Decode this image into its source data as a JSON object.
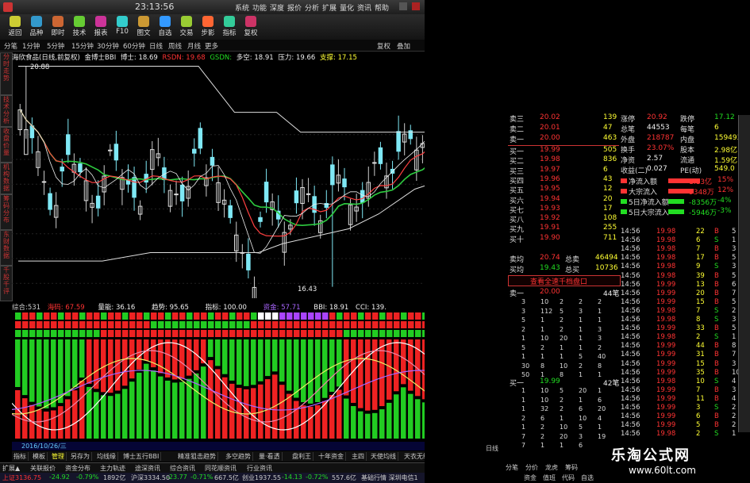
{
  "title_time": "23:13:56",
  "menu": [
    "系统",
    "功能",
    "深度",
    "报价",
    "分析",
    "扩展",
    "量化",
    "资讯",
    "帮助"
  ],
  "toolbar": [
    "返回",
    "品种",
    "即时",
    "技术",
    "报表",
    "F10",
    "图文",
    "自选",
    "交易",
    "步影",
    "指标",
    "复权"
  ],
  "period": [
    "分笔",
    "1分钟",
    "5分钟",
    "15分钟",
    "30分钟",
    "60分钟",
    "日线",
    "周线",
    "月线",
    "更多"
  ],
  "right_tabs": [
    "复权",
    "叠加"
  ],
  "indicator_line": {
    "name": "海欣食品(日线,前复权)",
    "bbi_label": "金博士BBI",
    "bbi": "博士: 18.69",
    "rsdn": "RSDN: 19.68",
    "gsdn": "GSDN:",
    "duokong": "多空: 18.91",
    "yali": "压力: 19.66",
    "zhicheng": "支撑: 17.15"
  },
  "price_high": "20.88",
  "price_low": "16.43",
  "chart_labels": {
    "yali": "压力",
    "duokong": "多空",
    "boshi": "博士"
  },
  "price_axis": [
    "19.50",
    "19.00",
    "18.50",
    "18.00",
    "17.50",
    "17.00",
    "16.50"
  ],
  "lower_header": {
    "zonghe": "综合:531",
    "haima": "海码: 67.59",
    "liangneng": "量能: 36.16",
    "qushi": "趋势: 95.65",
    "zhibiao": "指标: 100.00",
    "zijin": "资金: 57.71",
    "bbi": "BBI: 18.91",
    "cci": "CCI: 139."
  },
  "lower_right": [
    "BBI控:波段",
    "CCI:139.",
    "BBI:18.9",
    "海: 97.59",
    "量: 36.16",
    "势: 95.65",
    "指: 100.0",
    "金: 57.71"
  ],
  "lower_axis": [
    "600.0",
    "500.0",
    "400.0",
    "300.0",
    "200.0",
    "100.0"
  ],
  "date_label": "2016/10/26/三",
  "left_vtabs": [
    "分时走势",
    "技术分析",
    "收盘价量",
    "机构数据",
    "筹码分布",
    "东财数据",
    "千股千评"
  ],
  "bottom_tabs": [
    "指标",
    "模板",
    "管理",
    "另存为",
    "均线缘",
    "博士五行BBI",
    "精准狙击趋势",
    "多空趋势",
    "量·看透",
    "盘利王",
    "十年资金",
    "主四",
    "天使均线",
    "天衣无缝"
  ],
  "bottom_tabs2": [
    "扩展▲",
    "关联报价",
    "资金分布",
    "主力轨迹",
    "途深资讯",
    "综合资讯",
    "同花顺资讯",
    "行业资讯"
  ],
  "status": {
    "sh": "上证3136.75",
    "sh_chg": "-24.92",
    "sh_pct": "-0.79%",
    "sh_amt": "1892亿",
    "sz": "沪深3334.50",
    "sz_chg": "-23.77",
    "sz_pct": "-0.71%",
    "sz_amt": "667.5亿",
    "cy": "创业1937.55",
    "cy_chg": "-14.13",
    "cy_pct": "-0.72%",
    "cy_amt": "557.6亿"
  },
  "status_right": "基础行情 深圳电信1",
  "orderbook_sell": [
    {
      "l": "卖三",
      "p": "20.02",
      "v": "139"
    },
    {
      "l": "卖二",
      "p": "20.01",
      "v": "47"
    },
    {
      "l": "卖一",
      "p": "20.00",
      "v": "463"
    }
  ],
  "orderbook_buy": [
    {
      "l": "买一",
      "p": "19.99",
      "v": "505"
    },
    {
      "l": "买二",
      "p": "19.98",
      "v": "836"
    },
    {
      "l": "买三",
      "p": "19.97",
      "v": "6"
    },
    {
      "l": "买四",
      "p": "19.96",
      "v": "43"
    },
    {
      "l": "买五",
      "p": "19.95",
      "v": "12"
    },
    {
      "l": "买六",
      "p": "19.94",
      "v": "20"
    },
    {
      "l": "买七",
      "p": "19.93",
      "v": "17"
    },
    {
      "l": "买八",
      "p": "19.92",
      "v": "108"
    },
    {
      "l": "买九",
      "p": "19.91",
      "v": "255"
    },
    {
      "l": "买十",
      "p": "19.90",
      "v": "711"
    }
  ],
  "avg_sell": {
    "l": "卖均",
    "p": "20.74",
    "t": "总卖",
    "v": "46494"
  },
  "avg_buy": {
    "l": "买均",
    "p": "19.43",
    "t": "总买",
    "v": "10736"
  },
  "stats": [
    {
      "a": "涨停",
      "b": "20.92",
      "c": "跌停",
      "d": "17.12"
    },
    {
      "a": "总笔",
      "b": "44553",
      "c": "每笔",
      "d": "6"
    },
    {
      "a": "外盘",
      "b": "218787",
      "c": "内盘",
      "d": "159493"
    },
    {
      "a": "换手",
      "b": "23.07%",
      "c": "股本",
      "d": "2.98亿"
    },
    {
      "a": "净资",
      "b": "2.57",
      "c": "流通",
      "d": "1.59亿"
    },
    {
      "a": "收益(二)",
      "b": "0.027",
      "c": "PE(动)",
      "d": "549.0"
    }
  ],
  "flows": [
    {
      "l": "净流入额",
      "v": "1.13亿",
      "p": "15%"
    },
    {
      "l": "大宗流入",
      "v": "9348万",
      "p": "12%"
    },
    {
      "l": "5日净流入额",
      "v": "-8356万",
      "p": "-4%"
    },
    {
      "l": "5日大宗流入",
      "v": "-5946万",
      "p": "-3%"
    }
  ],
  "queue_title": "查看全速千档盘口",
  "queue_sell": {
    "l": "卖一",
    "p": "20.00",
    "n": "44笔"
  },
  "queue_buy": {
    "l": "买一",
    "p": "19.99",
    "n": "42笔"
  },
  "queue_sell_rows": [
    [
      "3",
      "10",
      "2",
      "2",
      "2"
    ],
    [
      "3",
      "112",
      "5",
      "3",
      "1"
    ],
    [
      "5",
      "1",
      "2",
      "1",
      "1"
    ],
    [
      "2",
      "1",
      "2",
      "1",
      "3"
    ],
    [
      "1",
      "10",
      "20",
      "1",
      "3"
    ],
    [
      "5",
      "2",
      "1",
      "1",
      "2"
    ],
    [
      "1",
      "1",
      "1",
      "5",
      "40"
    ],
    [
      "30",
      "8",
      "10",
      "2",
      "8"
    ],
    [
      "50",
      "1",
      "8",
      "1",
      "1"
    ]
  ],
  "queue_buy_rows": [
    [
      "1",
      "10",
      "5",
      "20",
      "1"
    ],
    [
      "1",
      "10",
      "2",
      "1",
      "6"
    ],
    [
      "1",
      "32",
      "2",
      "6",
      "20"
    ],
    [
      "2",
      "6",
      "1",
      "10",
      "4"
    ],
    [
      "1",
      "2",
      "10",
      "5",
      "1"
    ],
    [
      "7",
      "2",
      "20",
      "3",
      "19"
    ],
    [
      "7",
      "1",
      "1",
      "6",
      "1"
    ]
  ],
  "ticks": [
    {
      "t": "14:56",
      "p": "19.98",
      "v": "22",
      "d": "B",
      "n": "5"
    },
    {
      "t": "14:56",
      "p": "19.98",
      "v": "6",
      "d": "S",
      "n": "1"
    },
    {
      "t": "14:56",
      "p": "19.98",
      "v": "7",
      "d": "B",
      "n": "3"
    },
    {
      "t": "14:56",
      "p": "19.98",
      "v": "17",
      "d": "B",
      "n": "5"
    },
    {
      "t": "14:56",
      "p": "19.98",
      "v": "9",
      "d": "S",
      "n": "3"
    },
    {
      "t": "14:56",
      "p": "19.98",
      "v": "39",
      "d": "B",
      "n": "5"
    },
    {
      "t": "14:56",
      "p": "19.99",
      "v": "13",
      "d": "B",
      "n": "6"
    },
    {
      "t": "14:56",
      "p": "19.99",
      "v": "20",
      "d": "B",
      "n": "7"
    },
    {
      "t": "14:56",
      "p": "19.99",
      "v": "15",
      "d": "B",
      "n": "5"
    },
    {
      "t": "14:56",
      "p": "19.98",
      "v": "7",
      "d": "S",
      "n": "2"
    },
    {
      "t": "14:56",
      "p": "19.98",
      "v": "8",
      "d": "S",
      "n": "3"
    },
    {
      "t": "14:56",
      "p": "19.99",
      "v": "33",
      "d": "B",
      "n": "5"
    },
    {
      "t": "14:56",
      "p": "19.98",
      "v": "2",
      "d": "S",
      "n": "1"
    },
    {
      "t": "14:56",
      "p": "19.99",
      "v": "44",
      "d": "B",
      "n": "8"
    },
    {
      "t": "14:56",
      "p": "19.99",
      "v": "31",
      "d": "B",
      "n": "7"
    },
    {
      "t": "14:56",
      "p": "19.99",
      "v": "15",
      "d": "B",
      "n": "3"
    },
    {
      "t": "14:56",
      "p": "19.99",
      "v": "35",
      "d": "B",
      "n": "10"
    },
    {
      "t": "14:56",
      "p": "19.98",
      "v": "10",
      "d": "S",
      "n": "4"
    },
    {
      "t": "14:56",
      "p": "19.99",
      "v": "7",
      "d": "B",
      "n": "3"
    },
    {
      "t": "14:56",
      "p": "19.99",
      "v": "11",
      "d": "B",
      "n": "4"
    },
    {
      "t": "14:56",
      "p": "19.99",
      "v": "3",
      "d": "S",
      "n": "2"
    },
    {
      "t": "14:56",
      "p": "19.99",
      "v": "6",
      "d": "B",
      "n": "2"
    },
    {
      "t": "14:56",
      "p": "19.99",
      "v": "5",
      "d": "B",
      "n": "2"
    },
    {
      "t": "14:56",
      "p": "19.98",
      "v": "2",
      "d": "S",
      "n": "1"
    }
  ],
  "right_bottom_tabs": [
    "日线",
    "分笔",
    "分价",
    "龙虎",
    "筹码"
  ],
  "right_bottom_tabs_b": [
    "资金",
    "值班",
    "代码",
    "自选"
  ],
  "watermark1": "乐淘公式网",
  "watermark2": "www.60lt.com",
  "colors": {
    "up": "#ff3b3b",
    "down": "#22dd22",
    "candle_up": "#7fe8f5",
    "ma_green": "#2ecc40",
    "ma_red": "#ff4040"
  }
}
